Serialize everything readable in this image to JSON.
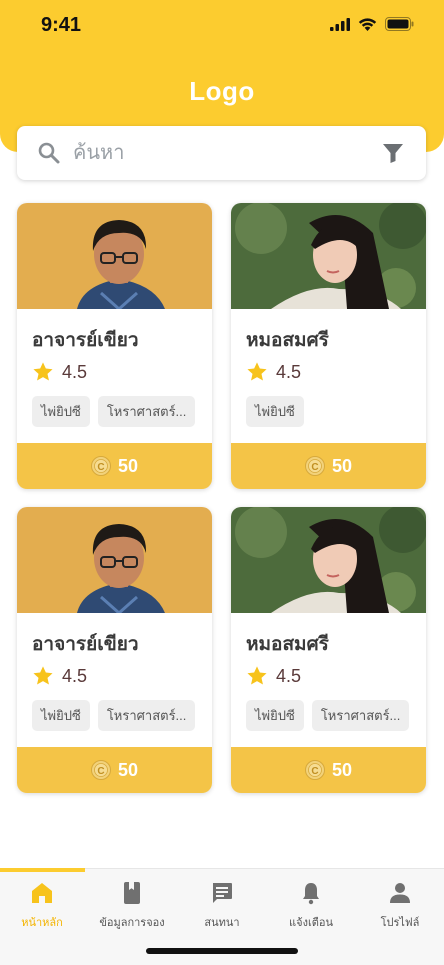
{
  "status": {
    "time": "9:41"
  },
  "header": {
    "logo": "Logo"
  },
  "search": {
    "placeholder": "ค้นหา",
    "value": ""
  },
  "cards": [
    {
      "name": "อาจารย์เขียว",
      "rating": "4.5",
      "tags": [
        "ไพ่ยิปซี",
        "โหราศาสตร์..."
      ],
      "price": "50"
    },
    {
      "name": "หมอสมศรี",
      "rating": "4.5",
      "tags": [
        "ไพ่ยิปซี"
      ],
      "price": "50"
    },
    {
      "name": "อาจารย์เขียว",
      "rating": "4.5",
      "tags": [
        "ไพ่ยิปซี",
        "โหราศาสตร์..."
      ],
      "price": "50"
    },
    {
      "name": "หมอสมศรี",
      "rating": "4.5",
      "tags": [
        "ไพ่ยิปซี",
        "โหราศาสตร์..."
      ],
      "price": "50"
    }
  ],
  "tabbar": {
    "items": [
      {
        "label": "หน้าหลัก",
        "icon": "home-icon",
        "active": true
      },
      {
        "label": "ข้อมูลการจอง",
        "icon": "book-icon",
        "active": false
      },
      {
        "label": "สนทนา",
        "icon": "chat-icon",
        "active": false
      },
      {
        "label": "แจ้งเตือน",
        "icon": "bell-icon",
        "active": false
      },
      {
        "label": "โปรไฟล์",
        "icon": "person-icon",
        "active": false
      }
    ]
  },
  "colors": {
    "brand": "#fccc2f",
    "price_bar": "#f4c447",
    "star": "#f7c31c"
  }
}
